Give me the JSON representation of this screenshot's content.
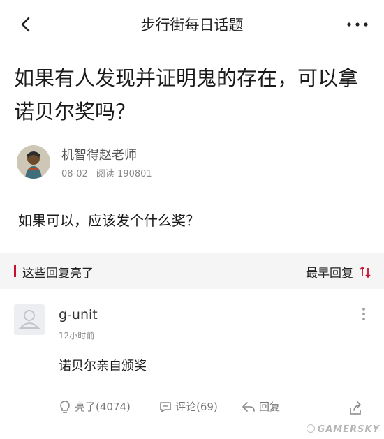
{
  "header": {
    "title": "步行街每日话题"
  },
  "post": {
    "title": "如果有人发现并证明鬼的存在，可以拿诺贝尔奖吗？",
    "author": "机智得赵老师",
    "date": "08-02",
    "reads_label": "阅读 190801",
    "body": "如果可以，应该发个什么奖？"
  },
  "replies_section": {
    "label": "这些回复亮了",
    "sort_label": "最早回复"
  },
  "comment": {
    "username": "g-unit",
    "time": "12小时前",
    "text": "诺贝尔亲自颁奖",
    "like_label": "亮了(4074)",
    "comment_label": "评论(69)",
    "reply_label": "回复"
  },
  "watermark": {
    "text": "GAMERSKY"
  },
  "colors": {
    "accent": "#c8102e",
    "section_bg": "#f5f5f5",
    "muted": "#888888"
  }
}
